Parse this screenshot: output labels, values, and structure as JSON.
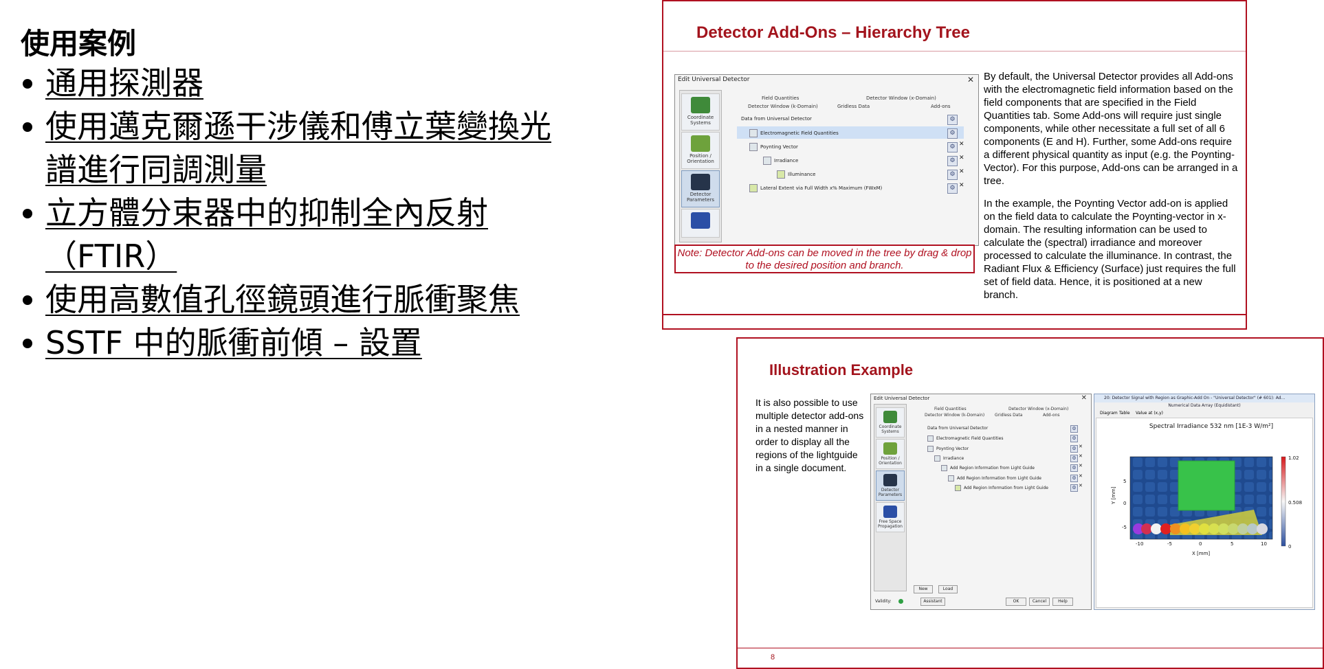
{
  "left": {
    "heading": "使用案例",
    "links": [
      "通用探測器",
      "使用邁克爾遜干涉儀和傅立葉變換光譜進行同調測量",
      "立方體分束器中的抑制全內反射（FTIR）",
      "使用高數值孔徑鏡頭進行脈衝聚焦",
      "SSTF 中的脈衝前傾 – 設置"
    ]
  },
  "slide1": {
    "title": "Detector Add-Ons – Hierarchy Tree",
    "para1": "By default, the Universal Detector provides all Add-ons with the electromagnetic field information based on the field components that are specified in the Field Quantities tab. Some Add-ons will require just single components, while other necessitate a full set of all 6 components (E and H). Further, some Add-ons require a different physical quantity as input (e.g. the Poynting-Vector). For this purpose, Add-ons can be arranged in a tree.",
    "para2": "In the example, the Poynting Vector add-on is applied on the field data to calculate the Poynting-vector in x-domain. The resulting information can be used to calculate the (spectral) irradiance and moreover processed to calculate the illuminance. In contrast, the Radiant Flux & Efficiency (Surface) just requires the full set of field data. Hence, it is positioned at a new branch.",
    "note": "Note: Detector Add-ons can be moved in the tree by drag & drop to the desired position and branch.",
    "dialog": {
      "title": "Edit Universal Detector",
      "close": "✕",
      "side_buttons": [
        "Coordinate Systems",
        "Position / Orientation",
        "Detector Parameters"
      ],
      "tabs_top": [
        "Field Quantities",
        "Detector Window (x-Domain)"
      ],
      "tabs_bottom": [
        "Detector Window (k-Domain)",
        "Gridless Data",
        "Add-ons"
      ],
      "tree": [
        "Data from Universal Detector",
        "Electromagnetic Field Quantities",
        "Poynting Vector",
        "Irradiance",
        "Illuminance",
        "Lateral Extent via Full Width x% Maximum (FWxM)"
      ]
    }
  },
  "slide2": {
    "title": "Illustration Example",
    "text": "It is also possible to use multiple detector add-ons in a nested manner in order to display all the regions of the lightguide in a single document.",
    "page_number": "8",
    "dialog": {
      "title": "Edit Universal Detector",
      "close": "✕",
      "side_buttons": [
        "Coordinate Systems",
        "Position / Orientation",
        "Detector Parameters",
        "Free Space Propagation"
      ],
      "tabs_top": [
        "Field Quantities",
        "Detector Window (x-Domain)"
      ],
      "tabs_bottom": [
        "Detector Window (k-Domain)",
        "Gridless Data",
        "Add-ons"
      ],
      "tree": [
        "Data from Universal Detector",
        "Electromagnetic Field Quantities",
        "Poynting Vector",
        "Irradiance",
        "Add Region Information from Light Guide",
        "Add Region Information from Light Guide",
        "Add Region Information from Light Guide"
      ],
      "buttons": [
        "New",
        "Load",
        "OK",
        "Cancel",
        "Help"
      ],
      "validity": "Validity:",
      "assistant": "Assistant"
    },
    "plot": {
      "window_title": "20: Detector Signal with Region as Graphic-Add On - \"Universal Detector\" (# 601): Ad...",
      "subtitle": "Numerical Data Array (Equidistant)",
      "tabs": [
        "Diagram",
        "Table",
        "Value at (x,y)"
      ],
      "chart_title": "Spectral Irradiance 532 nm  [1E-3 W/m²]",
      "xlabel": "X [mm]",
      "ylabel": "Y [mm]",
      "xticks": [
        "-10",
        "-5",
        "0",
        "5",
        "10"
      ],
      "yticks": [
        "5",
        "0",
        "-5"
      ],
      "colorbar_ticks": [
        "1.02",
        "0.508",
        "0"
      ]
    }
  }
}
